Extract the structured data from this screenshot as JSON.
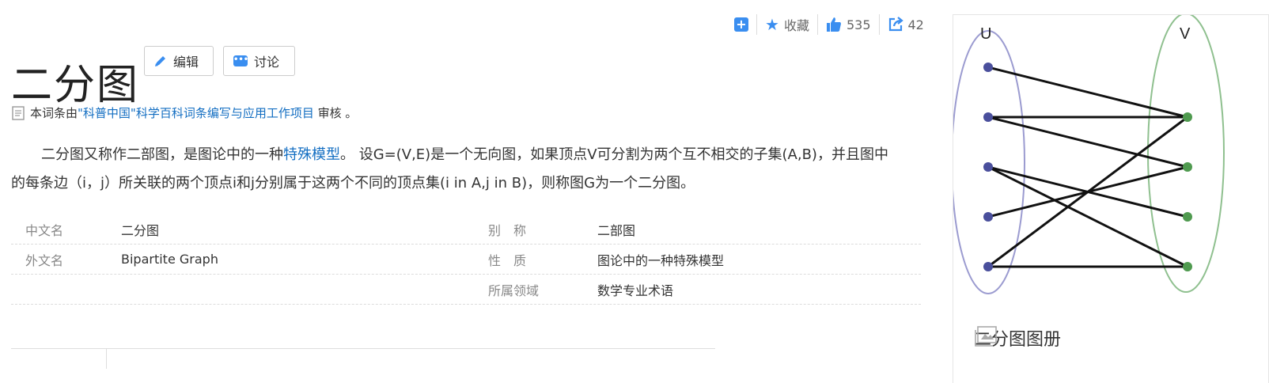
{
  "toolbar": {
    "add_icon": "plus-square-icon",
    "favorite_label": "收藏",
    "like_count": "535",
    "share_count": "42"
  },
  "title": "二分图",
  "buttons": {
    "edit": "编辑",
    "discuss": "讨论"
  },
  "review": {
    "prefix": "本词条由",
    "link": "\"科普中国\"科学百科词条编写与应用工作项目",
    "suffix": "审核 。"
  },
  "summary": {
    "part1": "二分图又称作二部图，是图论中的一种",
    "link": "特殊模型",
    "part2": "。 设G=(V,E)是一个无向图，如果顶点V可分割为两个互不相交的子集(A,B)，并且图中的每条边（i，j）所关联的两个顶点i和j分别属于这两个不同的顶点集(i in A,j in B)，则称图G为一个二分图。"
  },
  "infobox": [
    {
      "k1": "中文名",
      "v1": "二分图",
      "k2": "别　称",
      "v2": "二部图"
    },
    {
      "k1": "外文名",
      "v1": "Bipartite Graph",
      "k2": "性　质",
      "v2": "图论中的一种特殊模型"
    },
    {
      "k1": "",
      "v1": "",
      "k2": "所属领域",
      "v2": "数学专业术语"
    }
  ],
  "album": {
    "label_u": "U",
    "label_v": "V",
    "caption": "二分图图册",
    "colors": {
      "u_node": "#4a4f9c",
      "v_node": "#4f9a4f",
      "u_ellipse": "#9b9bd0",
      "v_ellipse": "#8fc08f",
      "edge": "#111111"
    }
  }
}
